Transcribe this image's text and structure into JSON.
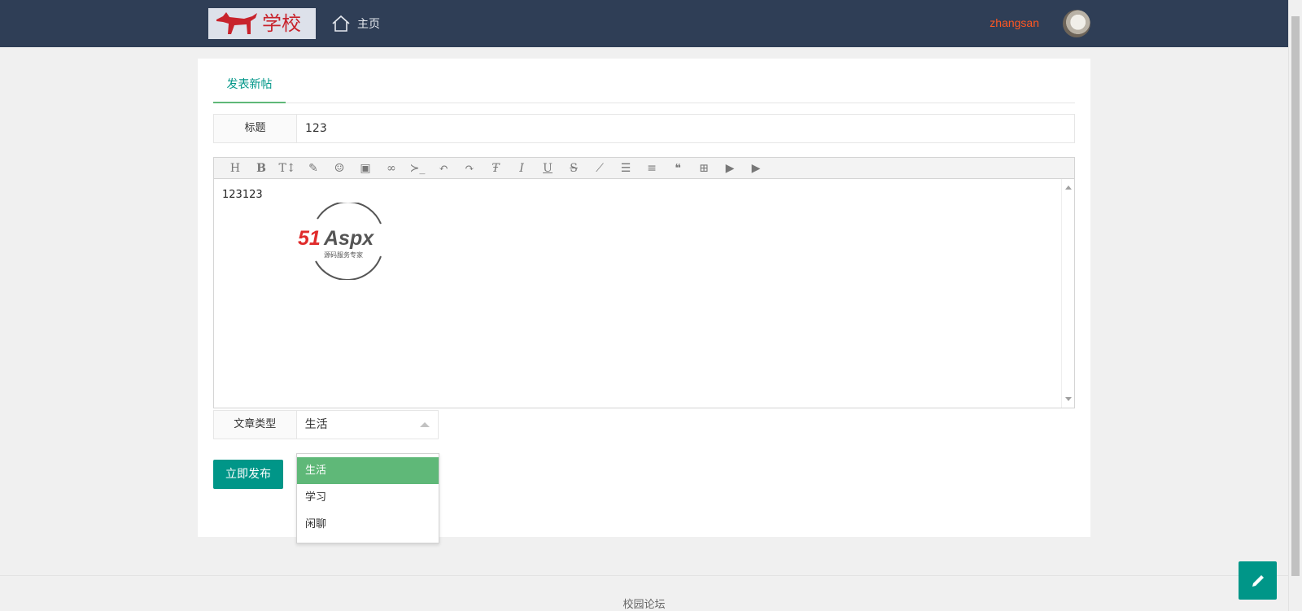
{
  "header": {
    "logo_text": "学校",
    "home_label": "主页",
    "username": "zhangsan"
  },
  "tab": {
    "label": "发表新帖"
  },
  "title_row": {
    "label": "标题",
    "value": "123"
  },
  "editor": {
    "toolbar_icons": [
      "heading-icon",
      "bold-icon",
      "text-size-icon",
      "pencil-icon",
      "emoji-icon",
      "image-icon",
      "link-icon",
      "code-icon",
      "undo-icon",
      "redo-icon",
      "font-icon",
      "italic-icon",
      "underline-icon",
      "strikethrough-icon",
      "brush-icon",
      "list-icon",
      "align-icon",
      "quote-icon",
      "table-icon",
      "video-icon",
      "video-icon"
    ],
    "content": "123123"
  },
  "watermark": {
    "brand": "51Aspx",
    "tagline": "源码服务专家"
  },
  "type_row": {
    "label": "文章类型",
    "selected": "生活",
    "options": [
      "生活",
      "学习",
      "闲聊"
    ]
  },
  "publish_label": "立即发布",
  "footer_text": "校园论坛",
  "colors": {
    "topbar": "#2f3e56",
    "accent": "#009688",
    "selected_option": "#5fb878",
    "username": "#ff5722"
  }
}
